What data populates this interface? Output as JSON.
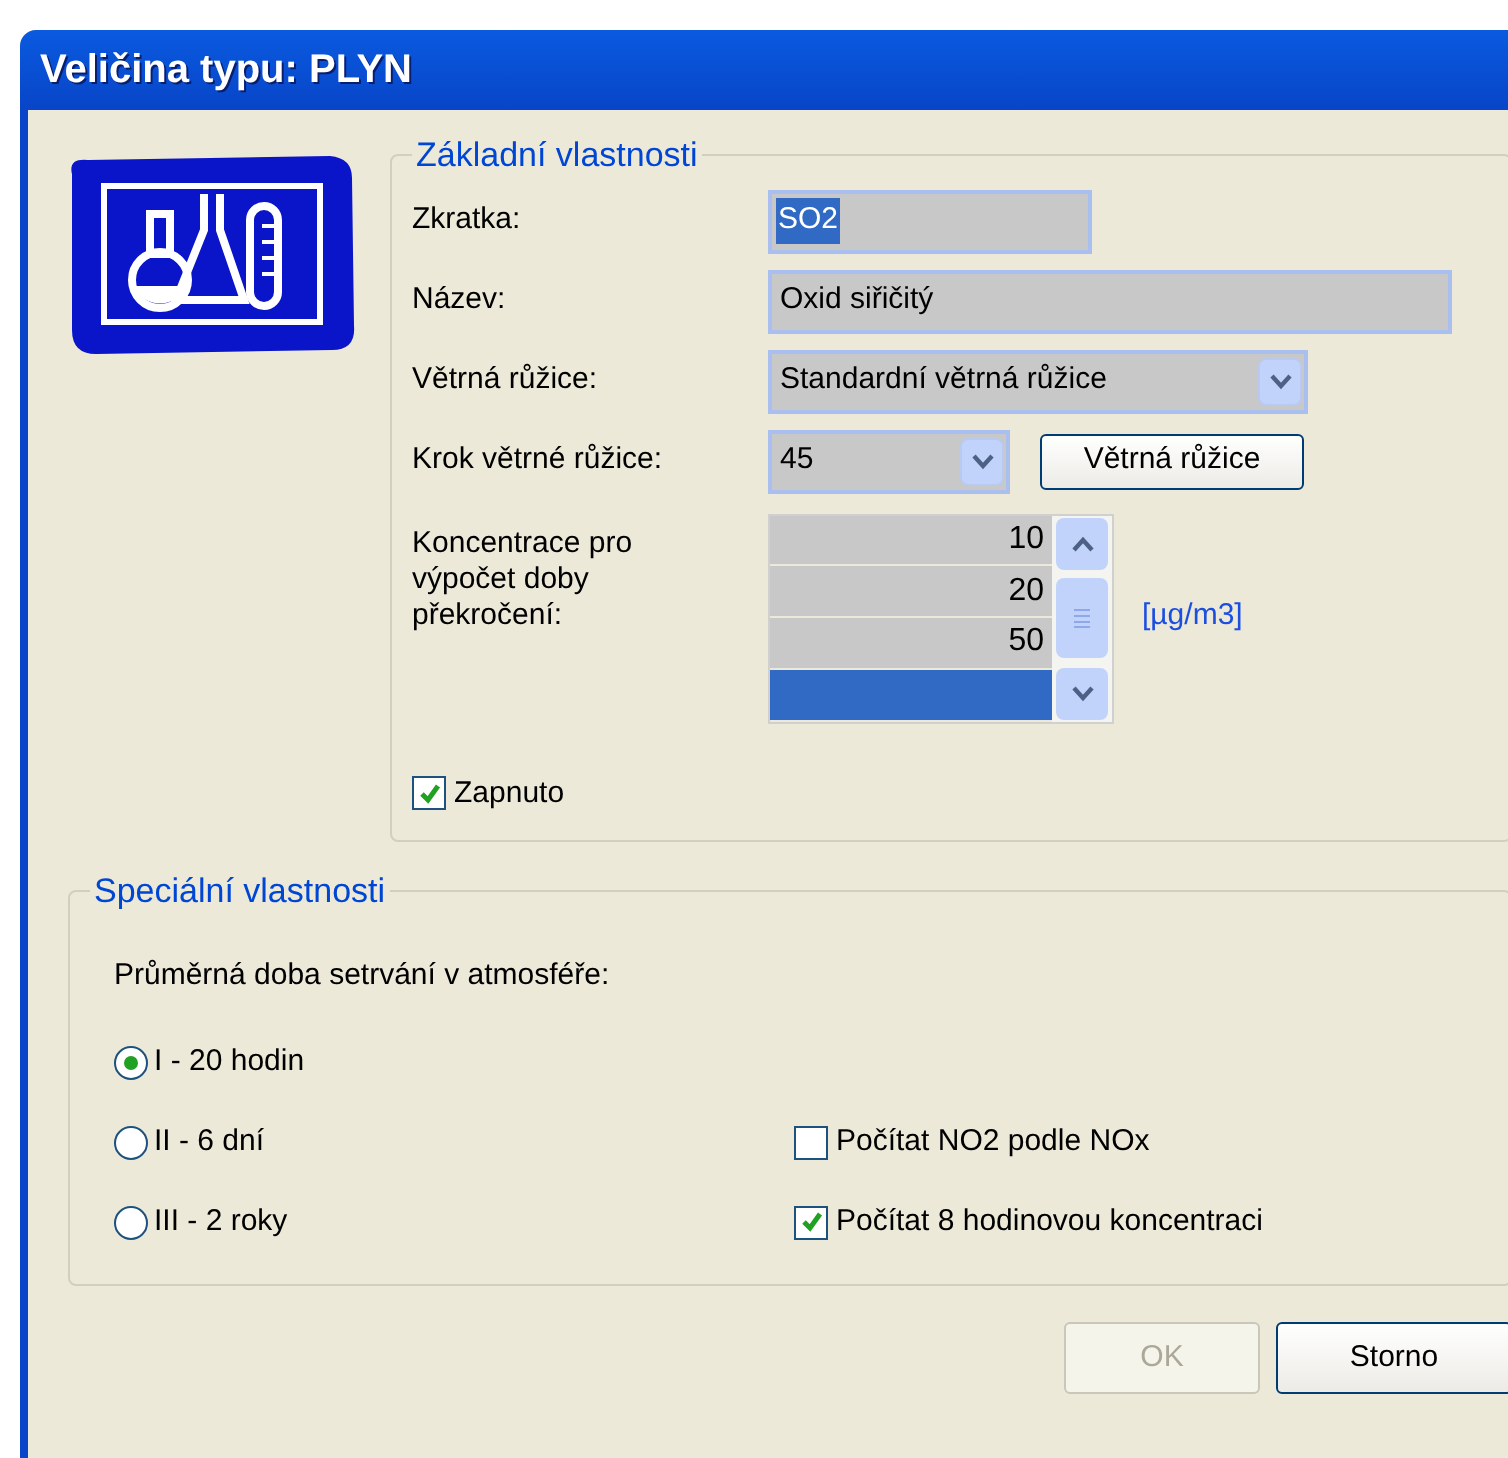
{
  "window": {
    "title": "Veličina typu: PLYN"
  },
  "basic": {
    "title": "Základní vlastnosti",
    "abbreviation": {
      "label": "Zkratka:",
      "value": "SO2"
    },
    "name": {
      "label": "Název:",
      "value": "Oxid siřičitý"
    },
    "wind_rose": {
      "label": "Větrná růžice:",
      "value": "Standardní větrná růžice"
    },
    "wind_step": {
      "label": "Krok větrné růžice:",
      "value": "45",
      "button": "Větrná růžice"
    },
    "concentrations": {
      "label": "Koncentrace pro výpočet doby překročení:",
      "unit": "[µg/m3]",
      "rows": [
        {
          "value": "10",
          "selected": false
        },
        {
          "value": "20",
          "selected": false
        },
        {
          "value": "50",
          "selected": false
        },
        {
          "value": "",
          "selected": true
        }
      ]
    },
    "enabled": {
      "label": "Zapnuto",
      "checked": true
    }
  },
  "special": {
    "title": "Speciální vlastnosti",
    "question": "Průměrná doba setrvání v atmosféře:",
    "options": [
      {
        "label": "I - 20 hodin",
        "selected": true
      },
      {
        "label": "II - 6 dní",
        "selected": false
      },
      {
        "label": "III - 2 roky",
        "selected": false
      }
    ],
    "checks": [
      {
        "label": "Počítat NO2 podle NOx",
        "checked": false
      },
      {
        "label": "Počítat 8 hodinovou koncentraci",
        "checked": true
      }
    ]
  },
  "buttons": [
    {
      "label": "OK",
      "disabled": true
    },
    {
      "label": "Storno",
      "disabled": false
    }
  ]
}
